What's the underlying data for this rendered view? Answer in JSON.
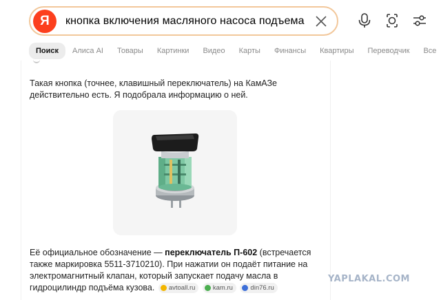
{
  "search": {
    "logo_letter": "Я",
    "query": "кнопка включения масляного насоса подъема куз…",
    "accent_color": "#fc3f1d",
    "border_color": "#f2c79a"
  },
  "toolbar": {
    "icons": [
      "microphone-icon",
      "camera-lens-icon",
      "settings-sliders-icon",
      "close-icon"
    ]
  },
  "tabs": [
    {
      "label": "Поиск",
      "active": true
    },
    {
      "label": "Алиса AI",
      "active": false
    },
    {
      "label": "Товары",
      "active": false
    },
    {
      "label": "Картинки",
      "active": false
    },
    {
      "label": "Видео",
      "active": false
    },
    {
      "label": "Карты",
      "active": false
    },
    {
      "label": "Финансы",
      "active": false
    },
    {
      "label": "Квартиры",
      "active": false
    },
    {
      "label": "Переводчик",
      "active": false
    },
    {
      "label": "Все",
      "active": false
    }
  ],
  "answer": {
    "intro_line1": "Такая кнопка (точнее, клавишный переключатель) на КамАЗе",
    "intro_line2": "действительно есть. Я подобрала информацию о ней.",
    "detail_prefix": "Её официальное обозначение — ",
    "detail_bold": "переключатель П-602",
    "detail_suffix": " (встречается",
    "detail_line2": "также маркировка 5511-3710210). При нажатии он подаёт питание на",
    "detail_line3": "электромагнитный клапан, который запускает подачу масла в",
    "detail_line4": "гидроцилиндр подъёма кузова.",
    "sources": [
      {
        "label": "avtoall.ru",
        "color": "#f3b600"
      },
      {
        "label": "kam.ru",
        "color": "#4caf50"
      },
      {
        "label": "din76.ru",
        "color": "#3d6fd8"
      }
    ]
  },
  "watermark": "YAPLAKAL.COM"
}
